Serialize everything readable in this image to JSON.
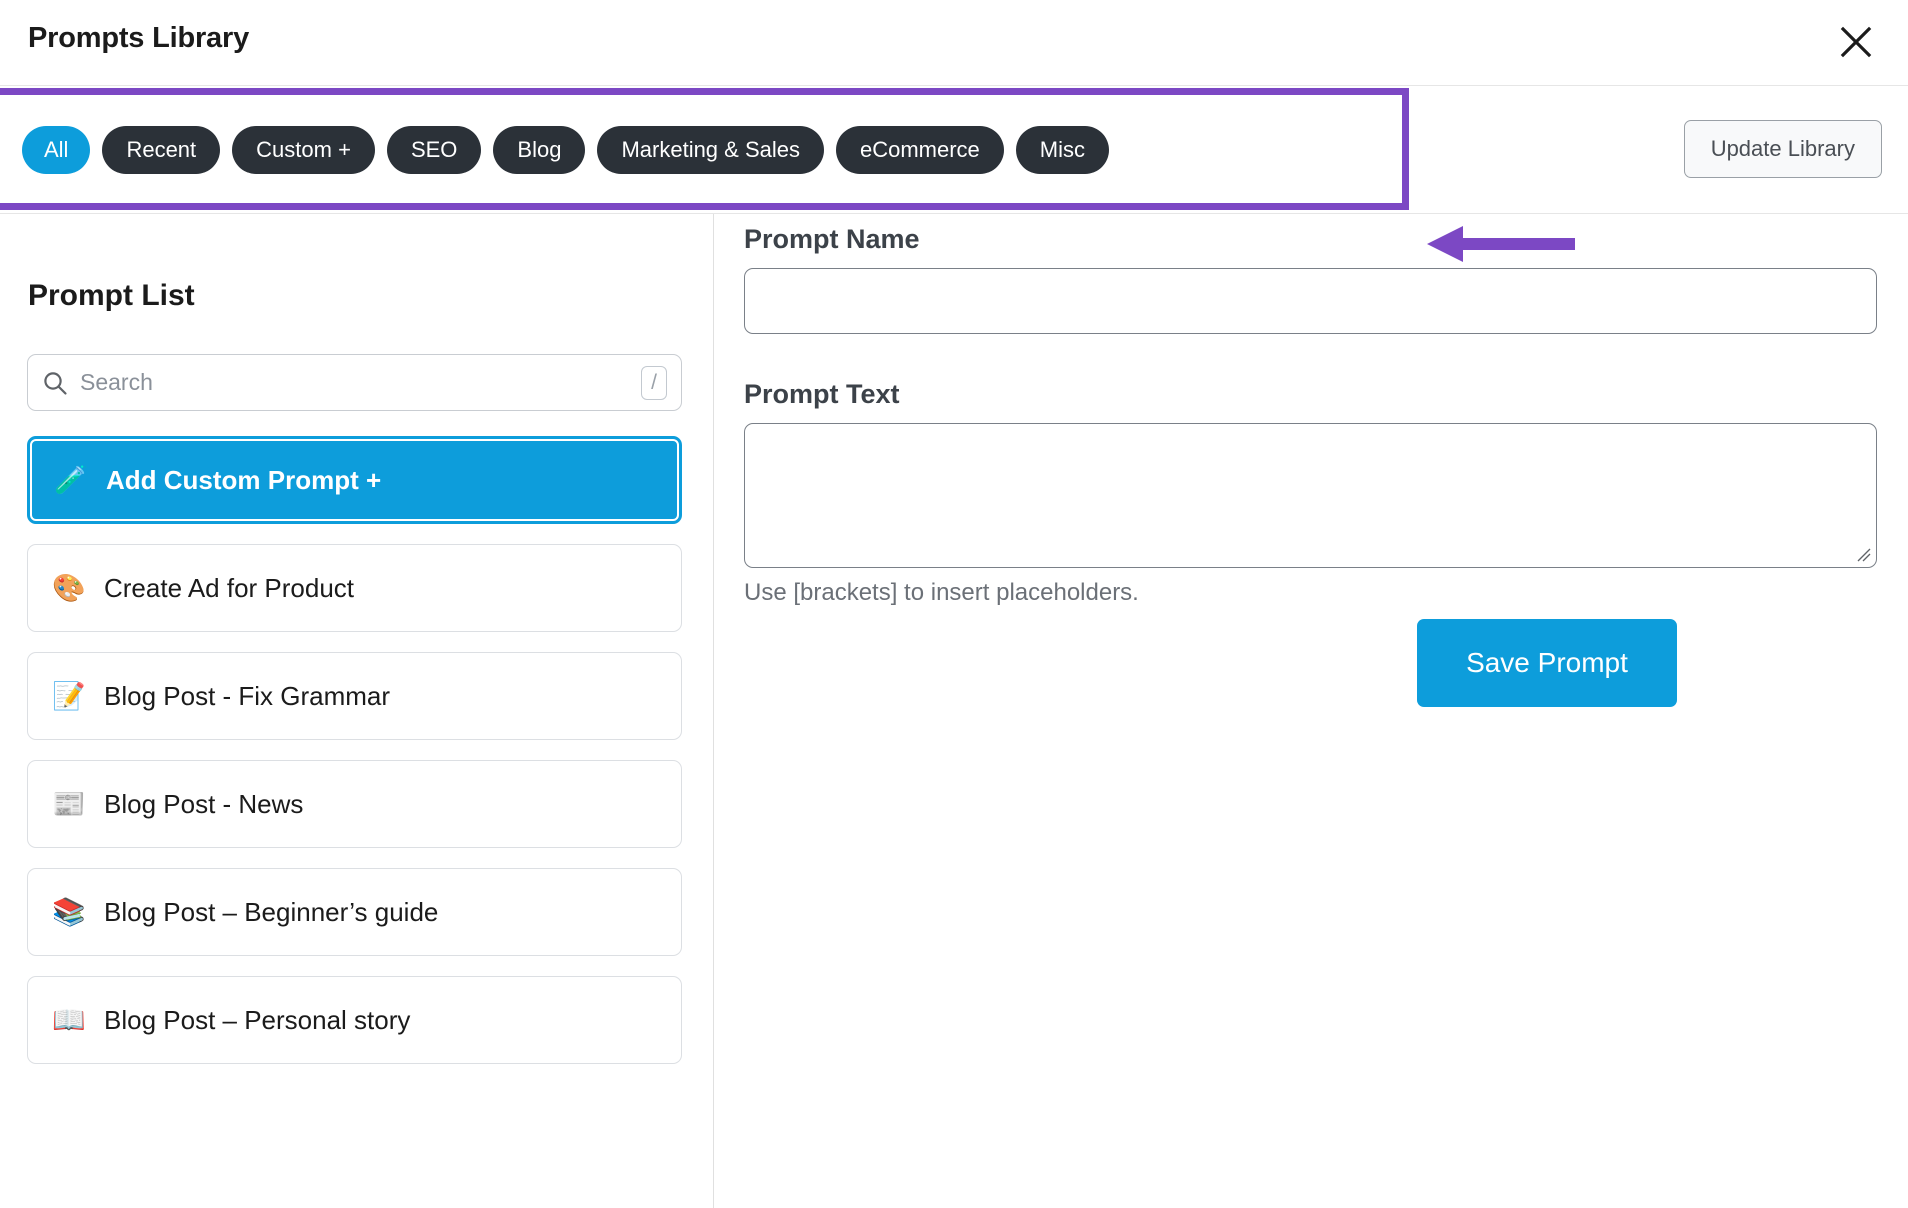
{
  "header": {
    "title": "Prompts Library",
    "close_icon": "close-icon"
  },
  "tabs": {
    "items": [
      {
        "label": "All",
        "active": true
      },
      {
        "label": "Recent",
        "active": false
      },
      {
        "label": "Custom +",
        "active": false
      },
      {
        "label": "SEO",
        "active": false
      },
      {
        "label": "Blog",
        "active": false
      },
      {
        "label": "Marketing & Sales",
        "active": false
      },
      {
        "label": "eCommerce",
        "active": false
      },
      {
        "label": "Misc",
        "active": false
      }
    ],
    "update_library_label": "Update Library",
    "highlight_color": "#7c48c4",
    "active_color": "#0d9ddb",
    "pill_color": "#2b3138"
  },
  "annotation": {
    "arrow_color": "#7c48c4",
    "arrow_direction": "left"
  },
  "left_pane": {
    "title": "Prompt List",
    "search": {
      "placeholder": "Search",
      "value": "",
      "shortcut_key": "/",
      "icon": "search-icon"
    },
    "items": [
      {
        "emoji": "🧪",
        "label": "Add Custom Prompt +",
        "selected": true
      },
      {
        "emoji": "🎨",
        "label": "Create Ad for Product",
        "selected": false
      },
      {
        "emoji": "📝",
        "label": "Blog Post - Fix Grammar",
        "selected": false
      },
      {
        "emoji": "📰",
        "label": "Blog Post - News",
        "selected": false
      },
      {
        "emoji": "📚",
        "label": "Blog Post – Beginner’s guide",
        "selected": false
      },
      {
        "emoji": "📖",
        "label": "Blog Post – Personal story",
        "selected": false
      }
    ]
  },
  "right_pane": {
    "prompt_name_label": "Prompt Name",
    "prompt_name_value": "",
    "prompt_name_placeholder": "",
    "prompt_text_label": "Prompt Text",
    "prompt_text_value": "",
    "prompt_text_placeholder": "",
    "hint": "Use [brackets] to insert placeholders.",
    "save_label": "Save Prompt",
    "save_color": "#0d9ddb"
  }
}
